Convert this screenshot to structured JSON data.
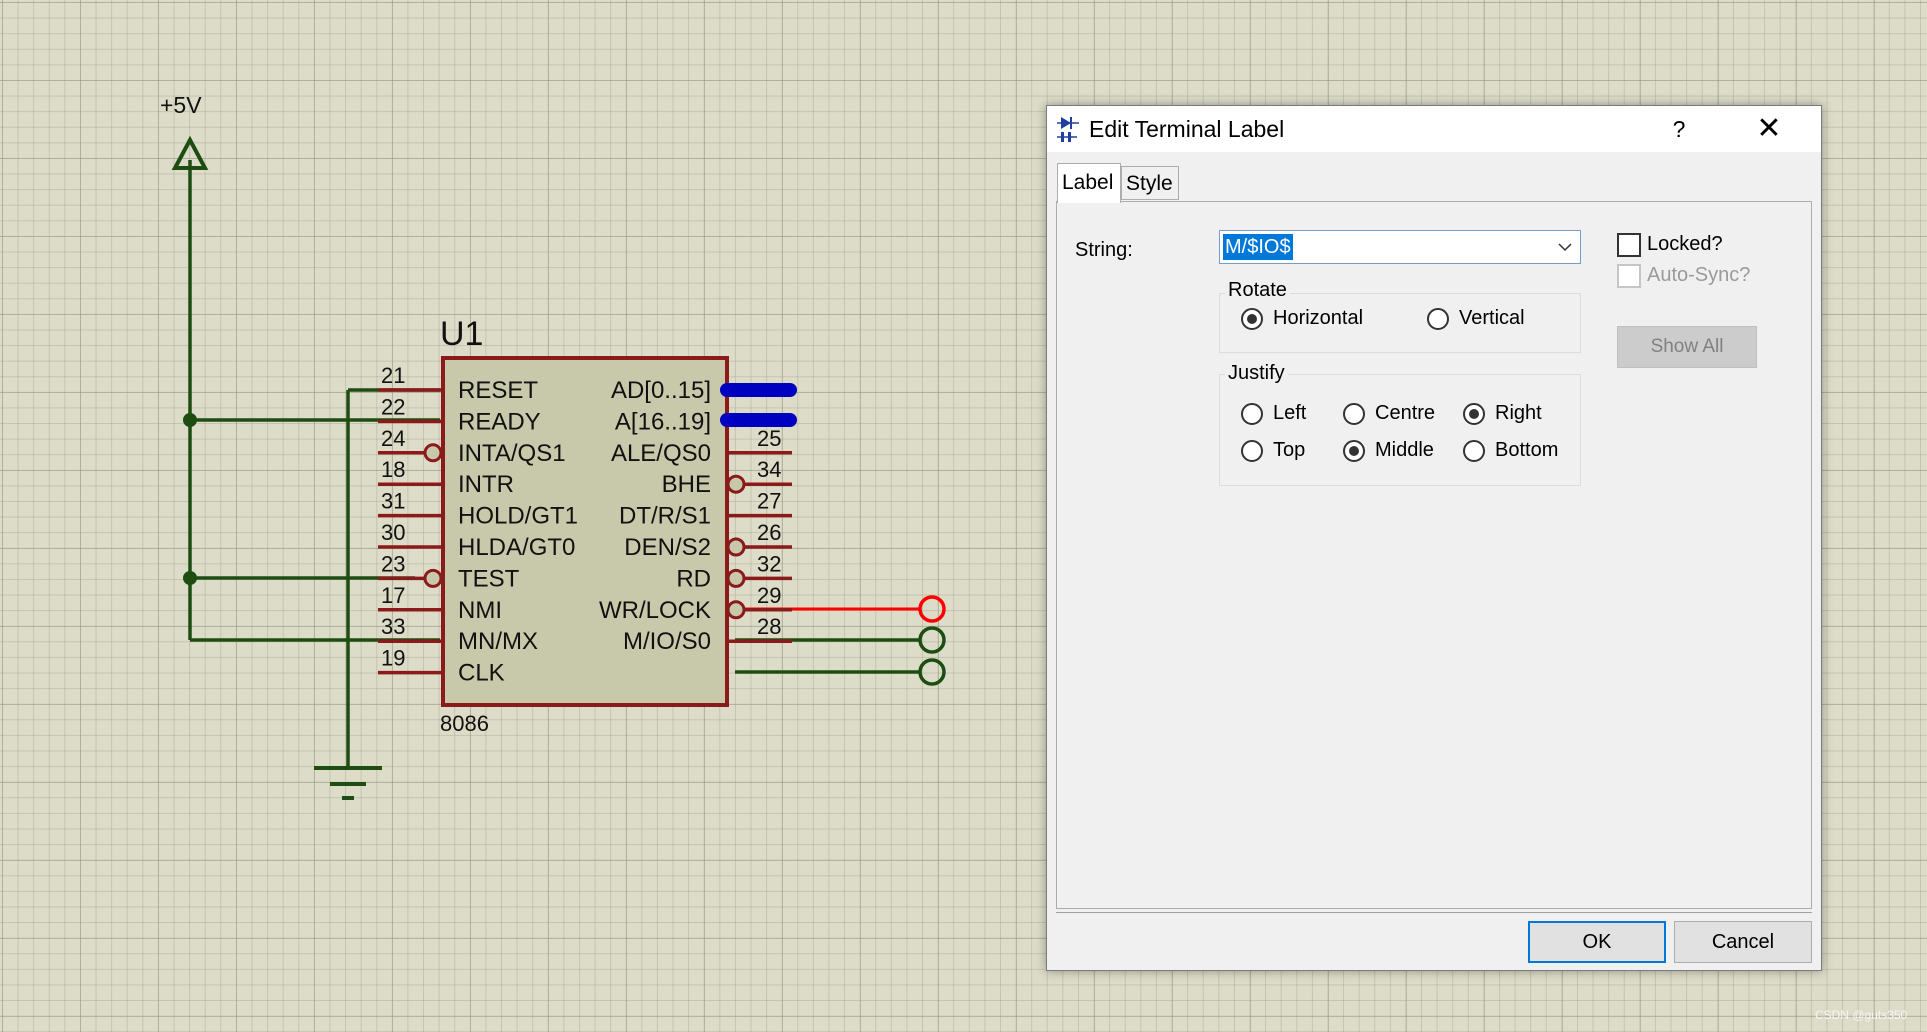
{
  "schematic": {
    "power_label": "+5V",
    "chip_ref": "U1",
    "chip_part": "8086",
    "left_pins": [
      {
        "num": "21",
        "name": "RESET"
      },
      {
        "num": "22",
        "name": "READY"
      },
      {
        "num": "24",
        "name": "INTA/QS1"
      },
      {
        "num": "18",
        "name": "INTR"
      },
      {
        "num": "31",
        "name": "HOLD/GT1"
      },
      {
        "num": "30",
        "name": "HLDA/GT0"
      },
      {
        "num": "23",
        "name": "TEST"
      },
      {
        "num": "17",
        "name": "NMI"
      },
      {
        "num": "33",
        "name": "MN/MX"
      },
      {
        "num": "19",
        "name": "CLK"
      }
    ],
    "right_pins": [
      {
        "num": "",
        "name": "AD[0..15]"
      },
      {
        "num": "",
        "name": "A[16..19]"
      },
      {
        "num": "25",
        "name": "ALE/QS0"
      },
      {
        "num": "34",
        "name": "BHE"
      },
      {
        "num": "27",
        "name": "DT/R/S1"
      },
      {
        "num": "26",
        "name": "DEN/S2"
      },
      {
        "num": "32",
        "name": "RD"
      },
      {
        "num": "29",
        "name": "WR/LOCK"
      },
      {
        "num": "28",
        "name": "M/IO/S0"
      }
    ]
  },
  "dialog": {
    "title": "Edit Terminal Label",
    "help": "?",
    "close": "✕",
    "tabs": [
      "Label",
      "Style"
    ],
    "string_label": "String:",
    "string_value": "M/$IO$",
    "rotate_title": "Rotate",
    "rotate_options": [
      "Horizontal",
      "Vertical"
    ],
    "rotate_selected": "Horizontal",
    "justify_title": "Justify",
    "justify_options": [
      "Left",
      "Centre",
      "Right",
      "Top",
      "Middle",
      "Bottom"
    ],
    "justify_selected": [
      "Right",
      "Middle"
    ],
    "locked_label": "Locked?",
    "autosync_label": "Auto-Sync?",
    "show_all": "Show All",
    "ok": "OK",
    "cancel": "Cancel"
  },
  "watermark": "CSDN @guts350",
  "colors": {
    "wire_green": "#1e4d12",
    "chip_red": "#8b1a1a",
    "chip_fill": "#c8c8aa",
    "bus_blue": "#0000c0",
    "selected_red": "#ff0000",
    "selection_blue": "#0078d7"
  }
}
